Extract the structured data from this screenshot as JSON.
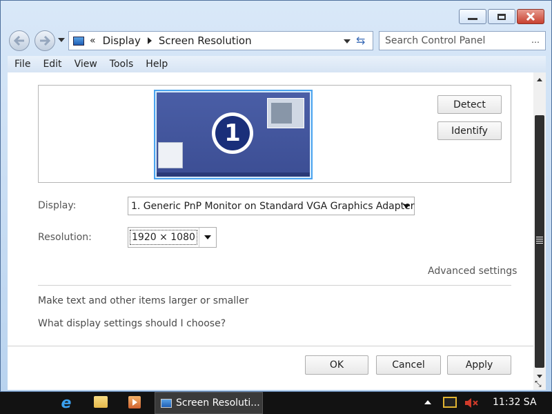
{
  "address": {
    "overflow": "«",
    "crumbs": [
      "Display",
      "Screen Resolution"
    ]
  },
  "search": {
    "placeholder": "Search Control Panel"
  },
  "menu": [
    "File",
    "Edit",
    "View",
    "Tools",
    "Help"
  ],
  "monitor": {
    "number": "1",
    "detect_label": "Detect",
    "identify_label": "Identify"
  },
  "display": {
    "label": "Display:",
    "value": "1. Generic PnP Monitor on Standard VGA Graphics Adapter"
  },
  "resolution": {
    "label": "Resolution:",
    "value": "1920 × 1080"
  },
  "advanced_label": "Advanced settings",
  "links": {
    "text_size": "Make text and other items larger or smaller",
    "which_settings": "What display settings should I choose?"
  },
  "buttons": {
    "ok": "OK",
    "cancel": "Cancel",
    "apply": "Apply"
  },
  "taskbar": {
    "task_label": "Screen Resoluti...",
    "clock": "11:32 SA"
  },
  "colors": {
    "accent": "#2b61b5",
    "close": "#c8402f",
    "taskbar": "#121212"
  }
}
